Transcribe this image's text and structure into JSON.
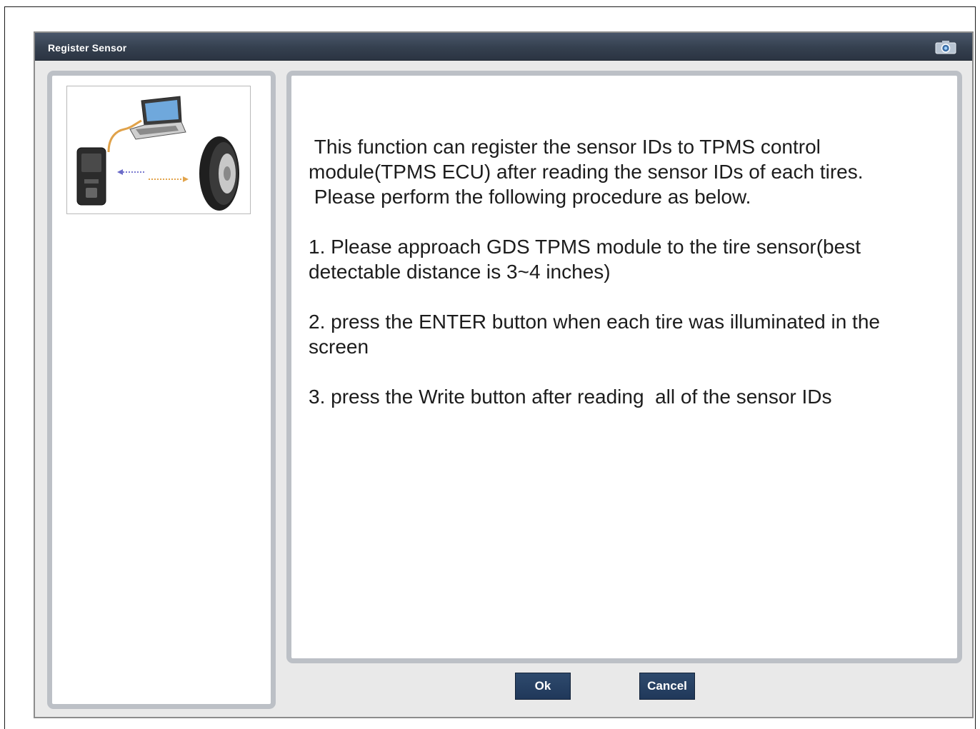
{
  "window": {
    "title": "Register Sensor",
    "icon": "camera-icon"
  },
  "left_panel": {
    "image": "tpms-module-laptop-tire-illustration"
  },
  "content": {
    "intro": " This function can register the sensor IDs to TPMS control\nmodule(TPMS ECU) after reading the sensor IDs of each tires.\n Please perform the following procedure as below.",
    "step1": "1. Please approach GDS TPMS module to the tire sensor(best\ndetectable distance is 3~4 inches)",
    "step2": "2. press the ENTER button when each tire was illuminated in the\nscreen",
    "step3": "3. press the Write button after reading  all of the sensor IDs"
  },
  "buttons": {
    "ok": "Ok",
    "cancel": "Cancel"
  },
  "colors": {
    "titlebar": "#35404f",
    "button": "#253f63",
    "panel_border": "#bcc0c6"
  }
}
